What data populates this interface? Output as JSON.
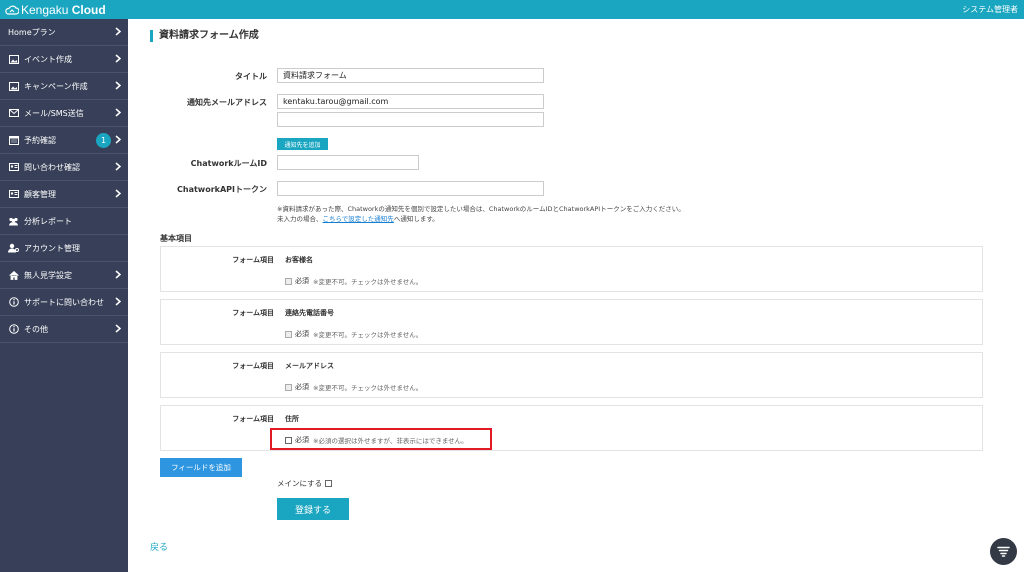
{
  "header": {
    "logo_prefix": "Kengaku",
    "logo_bold": "Cloud",
    "user_label": "システム管理者"
  },
  "sidebar": {
    "items": [
      {
        "label": "Homeプラン",
        "icon": "none",
        "chevron": true
      },
      {
        "label": "イベント作成",
        "icon": "image-icon",
        "chevron": true
      },
      {
        "label": "キャンペーン作成",
        "icon": "image-icon",
        "chevron": true
      },
      {
        "label": "メール/SMS送信",
        "icon": "envelope-icon",
        "chevron": true
      },
      {
        "label": "予約確認",
        "icon": "calendar-icon",
        "chevron": true,
        "badge": "1"
      },
      {
        "label": "問い合わせ確認",
        "icon": "id-card-icon",
        "chevron": true
      },
      {
        "label": "顧客管理",
        "icon": "id-card-icon",
        "chevron": true
      },
      {
        "label": "分析レポート",
        "icon": "users-icon",
        "chevron": false
      },
      {
        "label": "アカウント管理",
        "icon": "user-gear-icon",
        "chevron": false
      },
      {
        "label": "無人見学設定",
        "icon": "home-icon",
        "chevron": true
      },
      {
        "label": "サポートに問い合わせ",
        "icon": "info-icon",
        "chevron": true
      },
      {
        "label": "その他",
        "icon": "info-icon",
        "chevron": true
      }
    ]
  },
  "page": {
    "title": "資料請求フォーム作成"
  },
  "form": {
    "title_label": "タイトル",
    "title_value": "資料請求フォーム",
    "email_label": "通知先メールアドレス",
    "email_value_1": "kentaku.tarou@gmail.com",
    "email_value_2": "",
    "add_notify_button": "通知先を追加",
    "chatwork_room_label": "ChatworkルームID",
    "chatwork_room_value": "",
    "chatwork_token_label": "ChatworkAPIトークン",
    "chatwork_token_value": "",
    "note_line1": "※資料請求があった際、Chatworkの通知先を個別で設定したい場合は、ChatworkのルームIDとChatworkAPIトークンをご入力ください。",
    "note_line2_pre": "未入力の場合、",
    "note_line2_link": "こちらで設定した通知先",
    "note_line2_post": "へ通知します。"
  },
  "basic_section": {
    "heading": "基本項目",
    "fields": [
      {
        "label": "フォーム項目",
        "name": "お客様名",
        "required": "必須",
        "note": "※変更不可。チェックは外せません。",
        "editable": false
      },
      {
        "label": "フォーム項目",
        "name": "連絡先電話番号",
        "required": "必須",
        "note": "※変更不可。チェックは外せません。",
        "editable": false
      },
      {
        "label": "フォーム項目",
        "name": "メールアドレス",
        "required": "必須",
        "note": "※変更不可。チェックは外せません。",
        "editable": false
      },
      {
        "label": "フォーム項目",
        "name": "住所",
        "required": "必須",
        "note": "※必須の選択は外せますが、非表示にはできません。",
        "editable": true
      }
    ]
  },
  "actions": {
    "add_field_button": "フィールドを追加",
    "make_main_label": "メインにする",
    "submit_button": "登録する",
    "back_link": "戻る"
  },
  "colors": {
    "accent": "#1aa6c0",
    "sidebar_bg": "#374058",
    "add_button": "#2e96e0",
    "highlight": "#e01b24"
  }
}
